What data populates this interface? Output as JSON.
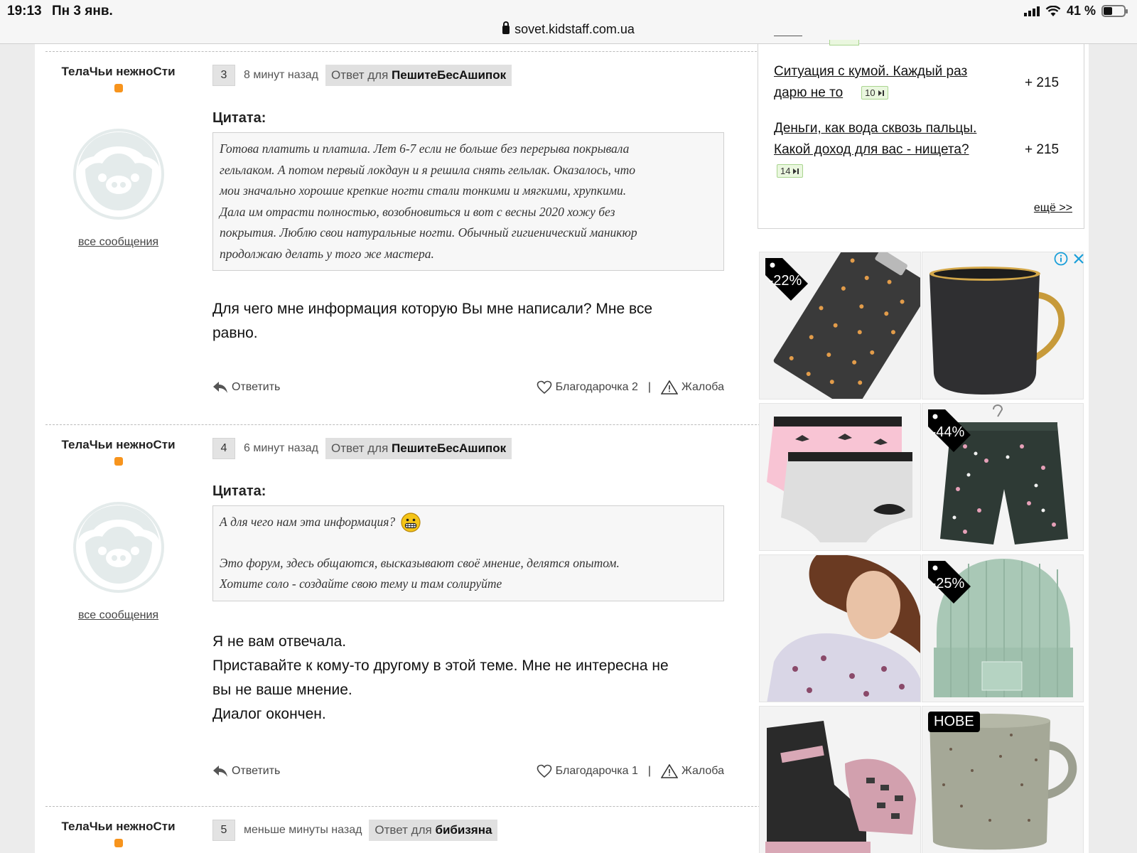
{
  "status_bar": {
    "time": "19:13",
    "date": "Пн 3 янв.",
    "battery": "41 %",
    "url": "sovet.kidstaff.com.ua"
  },
  "posts": [
    {
      "author": "ТелаЧьи нежноСти",
      "all_messages": "все сообщения",
      "number": "3",
      "time": "8 минут назад",
      "reply_prefix": "Ответ для",
      "reply_user": "ПешитеБесАшипок",
      "quote_label": "Цитата:",
      "quote_lines": [
        "Готова платить и платила. Лет 6-7 если не больше без перерыва покрывала",
        "гельлаком. А потом первый локдаун и я решила снять гельлак. Оказалось, что",
        "мои значально хорошие крепкие ногти стали тонкими и мягкими, хрупкими.",
        "Дала им отрасти полностью, возобновиться и вот с весны 2020 хожу без",
        "покрытия. Люблю свои натуральные ногти. Обычный гигиенический маникюр",
        "продолжаю делать у того же мастера."
      ],
      "message_lines": [
        "Для чего мне информация которую Вы мне написали? Мне все",
        "равно."
      ],
      "reply_button": "Ответить",
      "thanks": "Благодарочка 2",
      "complaint": "Жалоба"
    },
    {
      "author": "ТелаЧьи нежноСти",
      "all_messages": "все сообщения",
      "number": "4",
      "time": "6 минут назад",
      "reply_prefix": "Ответ для",
      "reply_user": "ПешитеБесАшипок",
      "quote_label": "Цитата:",
      "quote_first": "А для чего нам эта информация?",
      "quote_lines": [
        "Это форум, здесь общаются, высказывают своё мнение, делятся опытом.",
        "Хотите соло - создайте свою тему и там солируйте"
      ],
      "message_lines": [
        "Я не вам отвечала.",
        "Приставайте к кому-то другому в этой теме. Мне не интересна не",
        "вы не ваше мнение.",
        "Диалог окончен."
      ],
      "reply_button": "Ответить",
      "thanks": "Благодарочка 1",
      "complaint": "Жалоба"
    },
    {
      "author": "ТелаЧьи нежноСти",
      "number": "5",
      "time": "меньше минуты назад",
      "reply_prefix": "Ответ для",
      "reply_user": "бибизяна"
    }
  ],
  "sidebar": {
    "topics": [
      {
        "line1": "Ситуация с кумой. Каждый раз",
        "line2": "дарю не то",
        "comments": "10",
        "score": "+ 215"
      },
      {
        "line1": "Деньги, как вода сквозь пальцы.",
        "line2": "Какой доход для вас - нищета?",
        "comments": "14",
        "score": "+ 215"
      }
    ],
    "more": "ещё >>"
  },
  "ads": {
    "tags": [
      "-22%",
      "-44%",
      "-25%",
      "НОВЕ"
    ],
    "colors": {
      "accent": "#f7941d",
      "badge_bg": "#eaf7df"
    }
  }
}
